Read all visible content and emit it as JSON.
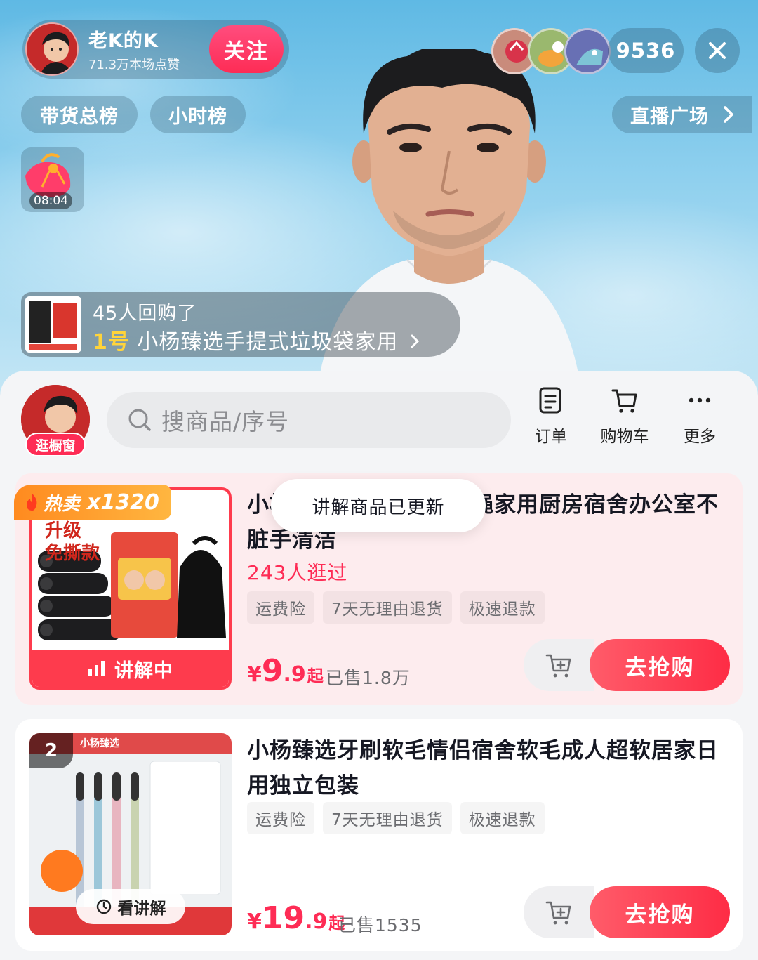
{
  "anchor": {
    "name": "老K的K",
    "likes": "71.3万本场点赞",
    "follow_label": "关注"
  },
  "viewers": {
    "count": "9536"
  },
  "rank_tabs": [
    "带货总榜",
    "小时榜"
  ],
  "plaza_label": "直播广场",
  "redpack": {
    "timer": "08:04"
  },
  "notice": {
    "line1": "45人回购了",
    "index": "1号",
    "product": "小杨臻选手提式垃圾袋家用"
  },
  "panel": {
    "shop_tag": "逛橱窗",
    "search_placeholder": "搜商品/序号",
    "actions": [
      {
        "label": "订单",
        "icon": "order-icon"
      },
      {
        "label": "购物车",
        "icon": "cart-icon"
      },
      {
        "label": "更多",
        "icon": "more-icon"
      }
    ],
    "toast": "讲解商品已更新"
  },
  "products": [
    {
      "hot_label": "热卖",
      "hot_count": "x1320",
      "img_text1": "升级",
      "img_text2": "免撕款",
      "live_label": "讲解中",
      "title": "小杨臻选手提式加厚抽绳家用厨房宿舍办公室不脏手清洁",
      "visits": "243人逛过",
      "tags": [
        "运费险",
        "7天无理由退货",
        "极速退款"
      ],
      "price_currency": "¥",
      "price_int": "9",
      "price_dec": ".9",
      "price_suffix": "起",
      "sold": "已售1.8万",
      "buy_label": "去抢购"
    },
    {
      "index": "2",
      "watch_label": "看讲解",
      "img_brand": "小杨臻选",
      "title": "小杨臻选牙刷软毛情侣宿舍软毛成人超软居家日用独立包装",
      "tags": [
        "运费险",
        "7天无理由退货",
        "极速退款"
      ],
      "price_currency": "¥",
      "price_int": "19",
      "price_dec": ".9",
      "price_suffix": "起",
      "sold": "已售1535",
      "buy_label": "去抢购"
    }
  ],
  "colors": {
    "accent": "#fe2c55",
    "buy": "#fe3b4d",
    "hot": "#ff8a1f",
    "notice_index": "#ffd43a"
  }
}
